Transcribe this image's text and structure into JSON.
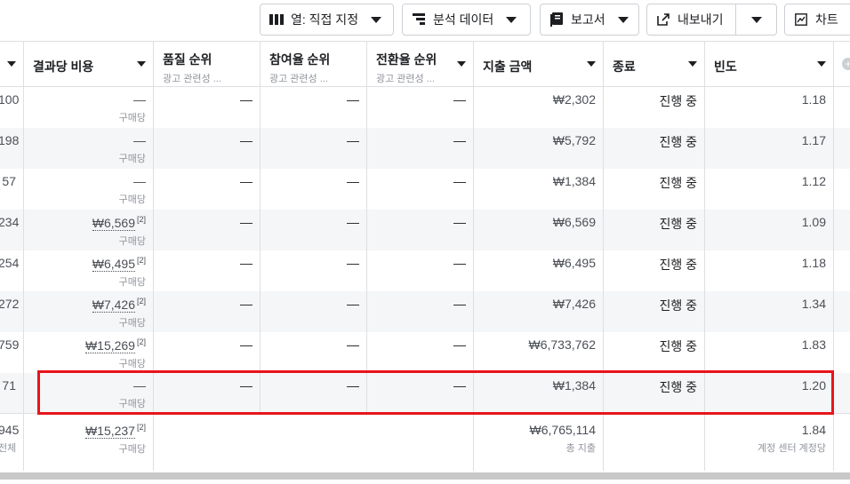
{
  "toolbar": {
    "columns_label": "열: 직접 지정",
    "breakdown_label": "분석 데이터",
    "reports_label": "보고서",
    "export_label": "내보내기",
    "chart_label": "차트"
  },
  "headers": {
    "c0": "",
    "cost_per_result": "결과당 비용",
    "quality_rank": "품질 순위",
    "quality_rank_sub": "광고 관련성 ...",
    "engagement_rank": "참여율 순위",
    "engagement_rank_sub": "광고 관련성 ...",
    "conversion_rank": "전환율 순위",
    "conversion_rank_sub": "광고 관련성 ...",
    "spend": "지출 금액",
    "ends": "종료",
    "frequency": "빈도"
  },
  "rows": [
    {
      "c0": "100",
      "cost": "—",
      "cost_sup": "",
      "cost_sub": "구매당",
      "q": "—",
      "e": "—",
      "c": "—",
      "spend": "₩2,302",
      "status": "진행 중",
      "freq": "1.18"
    },
    {
      "c0": "198",
      "cost": "—",
      "cost_sup": "",
      "cost_sub": "구매당",
      "q": "—",
      "e": "—",
      "c": "—",
      "spend": "₩5,792",
      "status": "진행 중",
      "freq": "1.17"
    },
    {
      "c0": "57",
      "cost": "—",
      "cost_sup": "",
      "cost_sub": "구매당",
      "q": "—",
      "e": "—",
      "c": "—",
      "spend": "₩1,384",
      "status": "진행 중",
      "freq": "1.12"
    },
    {
      "c0": "234",
      "cost": "₩6,569",
      "cost_sup": "[2]",
      "cost_sub": "구매당",
      "q": "—",
      "e": "—",
      "c": "—",
      "spend": "₩6,569",
      "status": "진행 중",
      "freq": "1.09"
    },
    {
      "c0": "254",
      "cost": "₩6,495",
      "cost_sup": "[2]",
      "cost_sub": "구매당",
      "q": "—",
      "e": "—",
      "c": "—",
      "spend": "₩6,495",
      "status": "진행 중",
      "freq": "1.18"
    },
    {
      "c0": "272",
      "cost": "₩7,426",
      "cost_sup": "[2]",
      "cost_sub": "구매당",
      "q": "—",
      "e": "—",
      "c": "—",
      "spend": "₩7,426",
      "status": "진행 중",
      "freq": "1.34"
    },
    {
      "c0": "759",
      "cost": "₩15,269",
      "cost_sup": "[2]",
      "cost_sub": "구매당",
      "q": "—",
      "e": "—",
      "c": "—",
      "spend": "₩6,733,762",
      "status": "진행 중",
      "freq": "1.83"
    },
    {
      "c0": "71",
      "cost": "—",
      "cost_sup": "",
      "cost_sub": "구매당",
      "q": "—",
      "e": "—",
      "c": "—",
      "spend": "₩1,384",
      "status": "진행 중",
      "freq": "1.20"
    }
  ],
  "totals": {
    "c0": "945",
    "c0_sub": "전체",
    "cost": "₩15,237",
    "cost_sup": "[2]",
    "cost_sub": "구매당",
    "spend": "₩6,765,114",
    "spend_sub": "총 지출",
    "freq": "1.84",
    "freq_sub": "계정 센터 계정당"
  },
  "colors": {
    "highlight": "#e8141c",
    "border": "#dddfe2",
    "alt_row": "#f5f6f7"
  }
}
